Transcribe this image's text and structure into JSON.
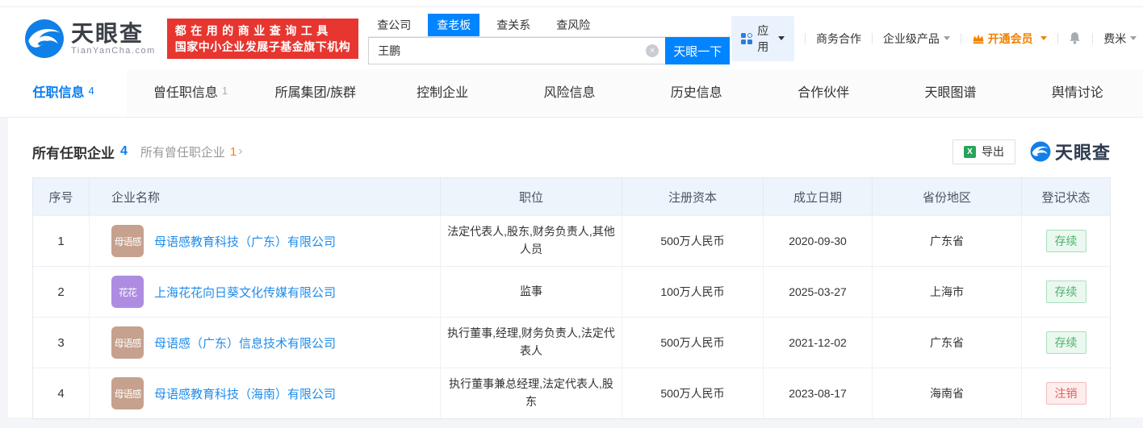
{
  "colors": {
    "accent_blue": "#0084ff",
    "promo_red": "#e73530",
    "vip_orange": "#f28100",
    "link_blue": "#1f8ceb",
    "status_active_green": "#4cb36d",
    "status_cancelled_red": "#ea5a5c"
  },
  "header": {
    "logo": {
      "title": "天眼查",
      "subtitle": "TianYanCha.com"
    },
    "promo": {
      "line1": "都在用的商业查询工具",
      "line2": "国家中小企业发展子基金旗下机构"
    },
    "search": {
      "tabs": [
        {
          "label": "查公司",
          "active": false
        },
        {
          "label": "查老板",
          "active": true
        },
        {
          "label": "查关系",
          "active": false
        },
        {
          "label": "查风险",
          "active": false
        }
      ],
      "value": "王鹏",
      "clear_icon": "×",
      "button": "天眼一下"
    },
    "nav": {
      "apps_label": "应用",
      "cooperation": "商务合作",
      "products": "企业级产品",
      "membership": "开通会员",
      "username": "费米"
    }
  },
  "tabs": [
    {
      "label": "任职信息",
      "count": "4",
      "active": true
    },
    {
      "label": "曾任职信息",
      "count": "1",
      "active": false
    },
    {
      "label": "所属集团/族群",
      "count": "",
      "active": false
    },
    {
      "label": "控制企业",
      "count": "",
      "active": false
    },
    {
      "label": "风险信息",
      "count": "",
      "active": false
    },
    {
      "label": "历史信息",
      "count": "",
      "active": false
    },
    {
      "label": "合作伙伴",
      "count": "",
      "active": false
    },
    {
      "label": "天眼图谱",
      "count": "",
      "active": false
    },
    {
      "label": "舆情讨论",
      "count": "",
      "active": false
    }
  ],
  "section": {
    "title": "所有任职企业",
    "title_count": "4",
    "secondary": "所有曾任职企业",
    "secondary_count": "1",
    "arrow": "›",
    "export_label": "导出",
    "excel_icon_glyph": "X",
    "watermark_logo": "天眼查"
  },
  "table": {
    "columns": [
      "序号",
      "企业名称",
      "职位",
      "注册资本",
      "成立日期",
      "省份地区",
      "登记状态"
    ],
    "rows": [
      {
        "index": "1",
        "logo_text": "母语感",
        "logo_color": "#c5a18e",
        "company": "母语感教育科技（广东）有限公司",
        "position": "法定代表人,股东,财务负责人,其他人员",
        "capital": "500万人民币",
        "date": "2020-09-30",
        "region": "广东省",
        "status": "存续",
        "status_type": "active"
      },
      {
        "index": "2",
        "logo_text": "花花",
        "logo_color": "#ad8ce2",
        "company": "上海花花向日葵文化传媒有限公司",
        "position": "监事",
        "capital": "100万人民币",
        "date": "2025-03-27",
        "region": "上海市",
        "status": "存续",
        "status_type": "active"
      },
      {
        "index": "3",
        "logo_text": "母语感",
        "logo_color": "#c5a18e",
        "company": "母语感（广东）信息技术有限公司",
        "position": "执行董事,经理,财务负责人,法定代表人",
        "capital": "500万人民币",
        "date": "2021-12-02",
        "region": "广东省",
        "status": "存续",
        "status_type": "active"
      },
      {
        "index": "4",
        "logo_text": "母语感",
        "logo_color": "#c5a18e",
        "company": "母语感教育科技（海南）有限公司",
        "position": "执行董事兼总经理,法定代表人,股东",
        "capital": "500万人民币",
        "date": "2023-08-17",
        "region": "海南省",
        "status": "注销",
        "status_type": "cancelled"
      }
    ]
  }
}
